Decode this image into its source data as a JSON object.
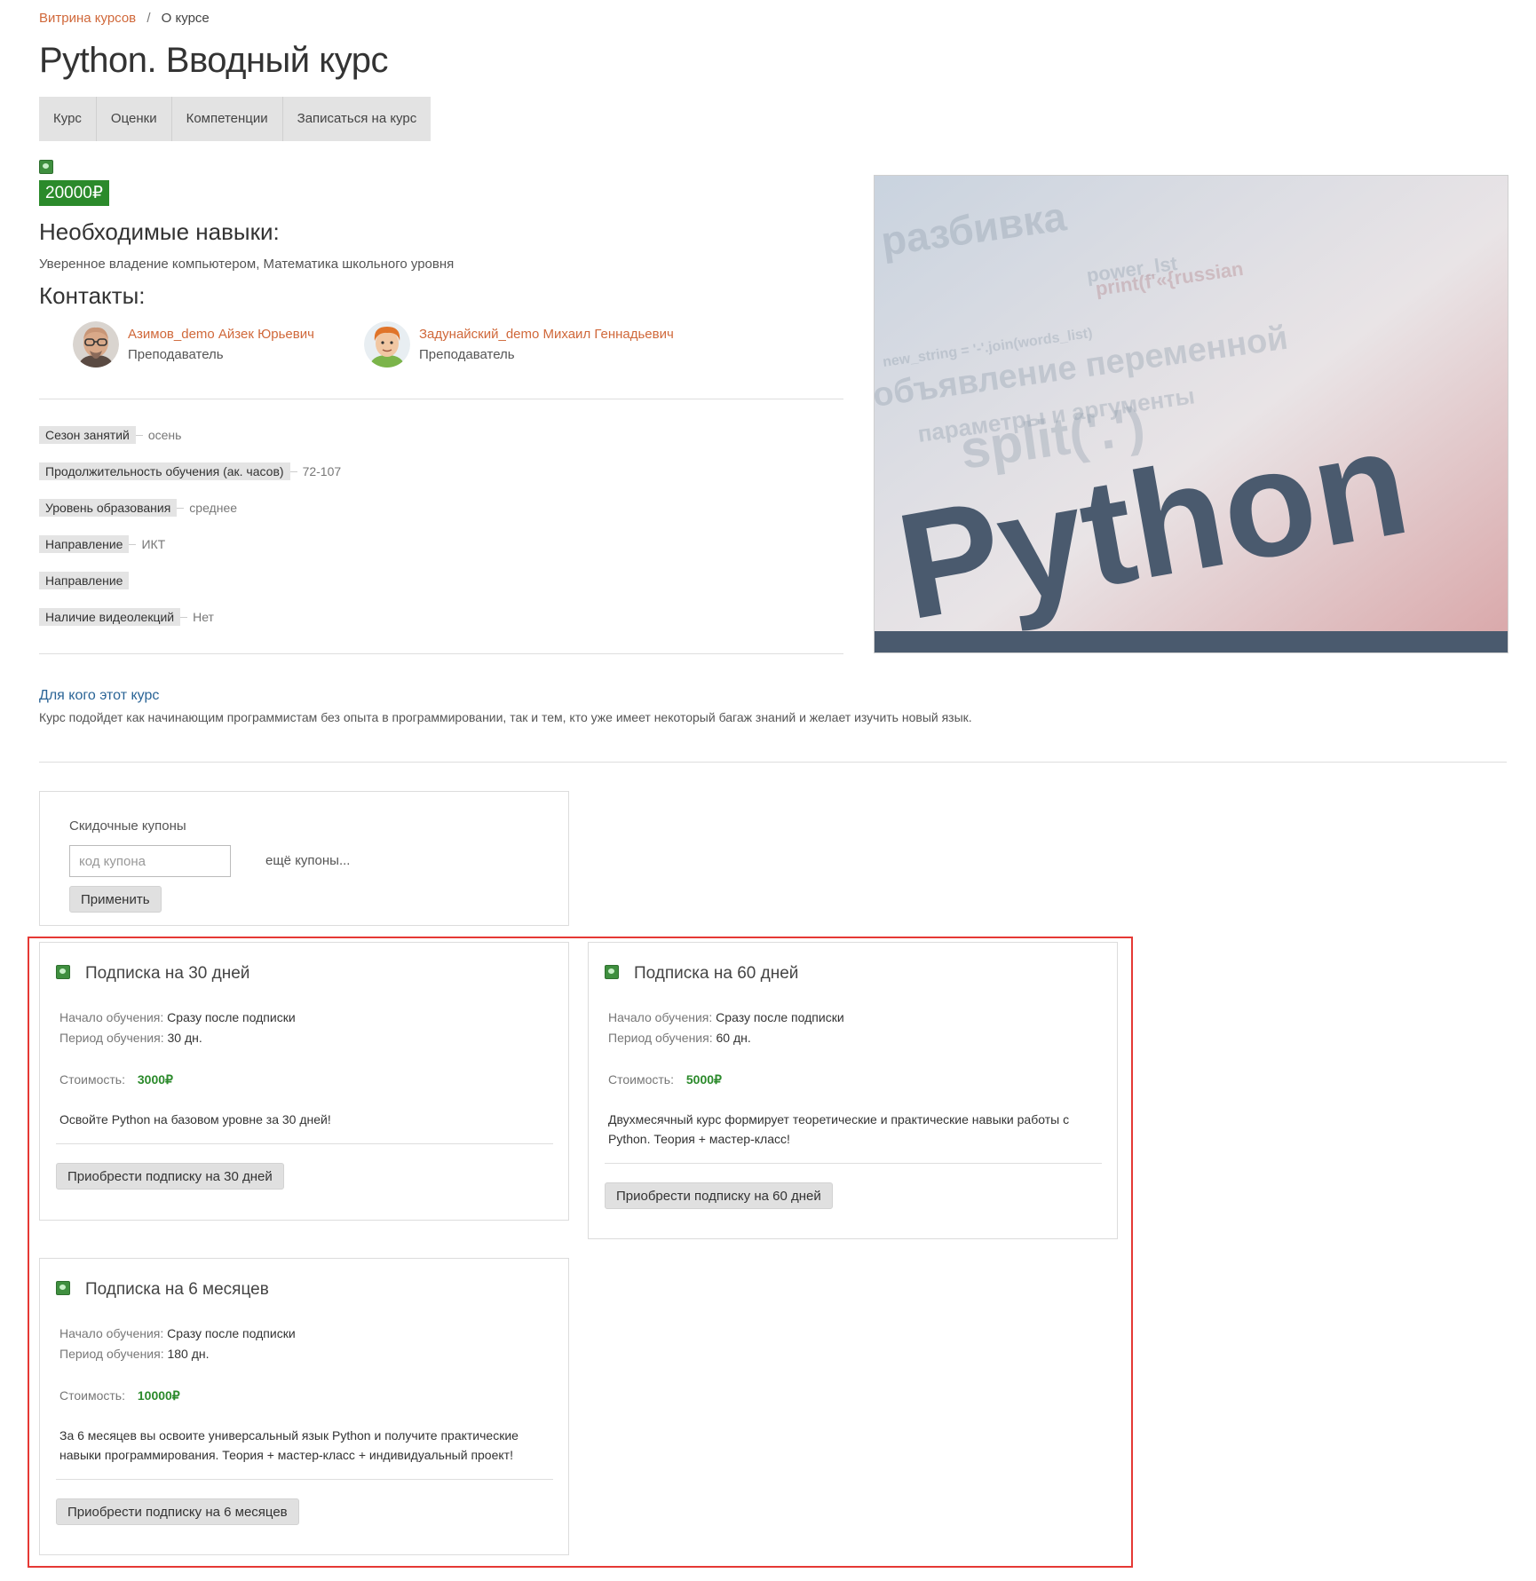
{
  "breadcrumb": {
    "home": "Витрина курсов",
    "separator": "/",
    "current": "О курсе"
  },
  "title": "Python. Вводный курс",
  "tabs": [
    "Курс",
    "Оценки",
    "Компетенции",
    "Записаться на курс"
  ],
  "price": "20000₽",
  "skills": {
    "heading": "Необходимые навыки:",
    "text": "Уверенное владение компьютером, Математика школьного уровня"
  },
  "contacts": {
    "heading": "Контакты:",
    "people": [
      {
        "name": "Азимов_demo Айзек Юрьевич",
        "role": "Преподаватель"
      },
      {
        "name": "Задунайский_demo Михаил Геннадьевич",
        "role": "Преподаватель"
      }
    ]
  },
  "properties": [
    {
      "label": "Сезон занятий",
      "value": "осень"
    },
    {
      "label": "Продолжительность обучения (ак. часов)",
      "value": "72-107"
    },
    {
      "label": "Уровень образования",
      "value": "среднее"
    },
    {
      "label": "Направление",
      "value": "ИКТ"
    },
    {
      "label": "Направление",
      "value": ""
    },
    {
      "label": "Наличие видеолекций",
      "value": "Нет"
    }
  ],
  "course_image": {
    "main_word": "Python",
    "bg_words": [
      "split('.')",
      "объявление переменной",
      "параметры и аргументы",
      "power_lst",
      "print(f'«{russian",
      "new_string = '-'.join(words_list)",
      "разбивка"
    ]
  },
  "for_whom": {
    "title": "Для кого этот курс",
    "text": "Курс подойдет как начинающим программистам без опыта в программировании, так и тем, кто уже имеет некоторый багаж знаний и желает изучить новый язык."
  },
  "coupons": {
    "title": "Скидочные купоны",
    "placeholder": "код купона",
    "more": "ещё купоны...",
    "apply": "Применить"
  },
  "subscriptions": [
    {
      "title": "Подписка на 30 дней",
      "start_label": "Начало обучения:",
      "start": "Сразу после подписки",
      "period_label": "Период обучения:",
      "period": "30 дн.",
      "cost_label": "Стоимость:",
      "cost": "3000₽",
      "description": "Освойте Python на базовом уровне за 30 дней!",
      "button": "Приобрести подписку на 30 дней"
    },
    {
      "title": "Подписка на 60 дней",
      "start_label": "Начало обучения:",
      "start": "Сразу после подписки",
      "period_label": "Период обучения:",
      "period": "60 дн.",
      "cost_label": "Стоимость:",
      "cost": "5000₽",
      "description": "Двухмесячный курс формирует теоретические и практические навыки работы с Python. Теория + мастер-класс!",
      "button": "Приобрести подписку на 60 дней"
    },
    {
      "title": "Подписка на 6 месяцев",
      "start_label": "Начало обучения:",
      "start": "Сразу после подписки",
      "period_label": "Период обучения:",
      "period": "180 дн.",
      "cost_label": "Стоимость:",
      "cost": "10000₽",
      "description": "За 6 месяцев вы освоите универсальный язык Python и получите практические навыки программирования. Теория + мастер-класс + индивидуальный проект!",
      "button": "Приобрести подписку на 6 месяцев"
    }
  ],
  "colors": {
    "link": "#d0683a",
    "price_bg": "#2b8a2b",
    "price_text": "#2b8a2b",
    "highlight_frame": "#e53935",
    "section_link": "#2a6496",
    "image_text": "#4a5a6e"
  },
  "icons": {
    "course_status": "green-badge-icon",
    "subscription": "green-badge-icon"
  }
}
